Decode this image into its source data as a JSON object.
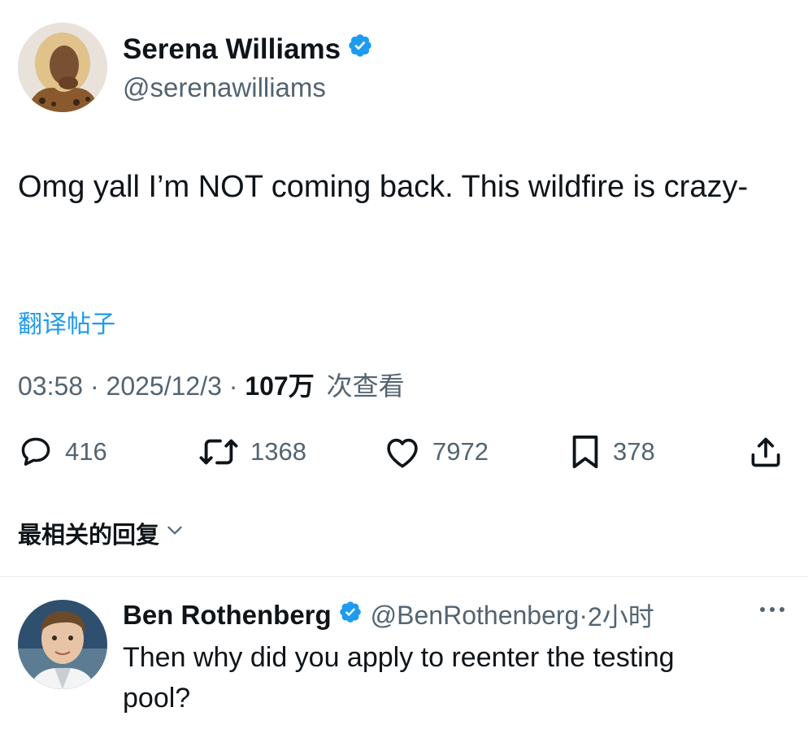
{
  "tweet": {
    "author": {
      "display_name": "Serena Williams",
      "handle": "@serenawilliams",
      "verified": true,
      "avatar_icon": "user-avatar-photo"
    },
    "text": "Omg yall I’m NOT coming back. This wildfire is crazy-",
    "translate_label": "翻译帖子",
    "meta": {
      "time": "03:58",
      "sep1": "·",
      "date": "2025/12/3",
      "sep2": "·",
      "views_count": "107万",
      "views_label": "次查看"
    },
    "actions": {
      "replies": "416",
      "reposts": "1368",
      "likes": "7972",
      "bookmarks": "378"
    }
  },
  "replies_sort": {
    "label": "最相关的回复",
    "icon": "chevron-down-icon"
  },
  "reply": {
    "author": {
      "display_name": "Ben Rothenberg",
      "handle": "@BenRothenberg",
      "sep": "·",
      "time": "2小时",
      "verified": true,
      "avatar_icon": "user-avatar-photo"
    },
    "text": "Then why did you apply to reenter the testing pool?"
  },
  "colors": {
    "text_primary": "#0f1419",
    "text_secondary": "#536471",
    "accent_blue": "#1d9bf0"
  }
}
